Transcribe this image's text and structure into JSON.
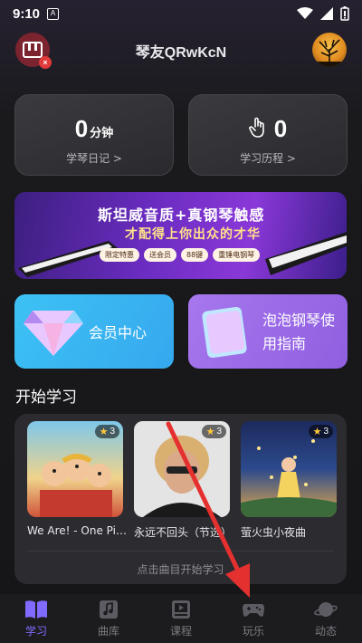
{
  "status_bar": {
    "time": "9:10",
    "notification": "A"
  },
  "header": {
    "title": "琴友QRwKcN",
    "app_icon": "piano-icon",
    "avatar": "tree-sunset-avatar"
  },
  "cards": [
    {
      "value": "0",
      "unit": "分钟",
      "label": "学琴日记 >"
    },
    {
      "value": "0",
      "unit": "",
      "label": "学习历程 >",
      "icon": "hand-icon"
    }
  ],
  "banner": {
    "line1": "斯坦威音质+真钢琴触感",
    "line2": "才配得上你出众的才华",
    "tags": [
      "限定特惠",
      "送会员",
      "88键",
      "重锤电钢琴"
    ]
  },
  "tiles": [
    {
      "label": "会员中心",
      "icon": "diamond-icon",
      "color": "#3db6f0"
    },
    {
      "label": "泡泡钢琴使用指南",
      "icon": "book-icon",
      "color": "#9d66e6"
    }
  ],
  "section": {
    "title": "开始学习"
  },
  "songs": [
    {
      "name": "We Are! - One Pie...",
      "stars": "3"
    },
    {
      "name": "永远不回头（节选）",
      "stars": "3"
    },
    {
      "name": "萤火虫小夜曲",
      "stars": "3"
    }
  ],
  "panel": {
    "hint": "点击曲目开始学习"
  },
  "nav": [
    {
      "label": "学习",
      "icon": "book-open-icon",
      "active": true
    },
    {
      "label": "曲库",
      "icon": "music-note-icon",
      "active": false
    },
    {
      "label": "课程",
      "icon": "video-icon",
      "active": false
    },
    {
      "label": "玩乐",
      "icon": "gamepad-icon",
      "active": false
    },
    {
      "label": "动态",
      "icon": "planet-icon",
      "active": false
    }
  ],
  "colors": {
    "accent": "#7f6bff",
    "arrow": "#e53030"
  }
}
